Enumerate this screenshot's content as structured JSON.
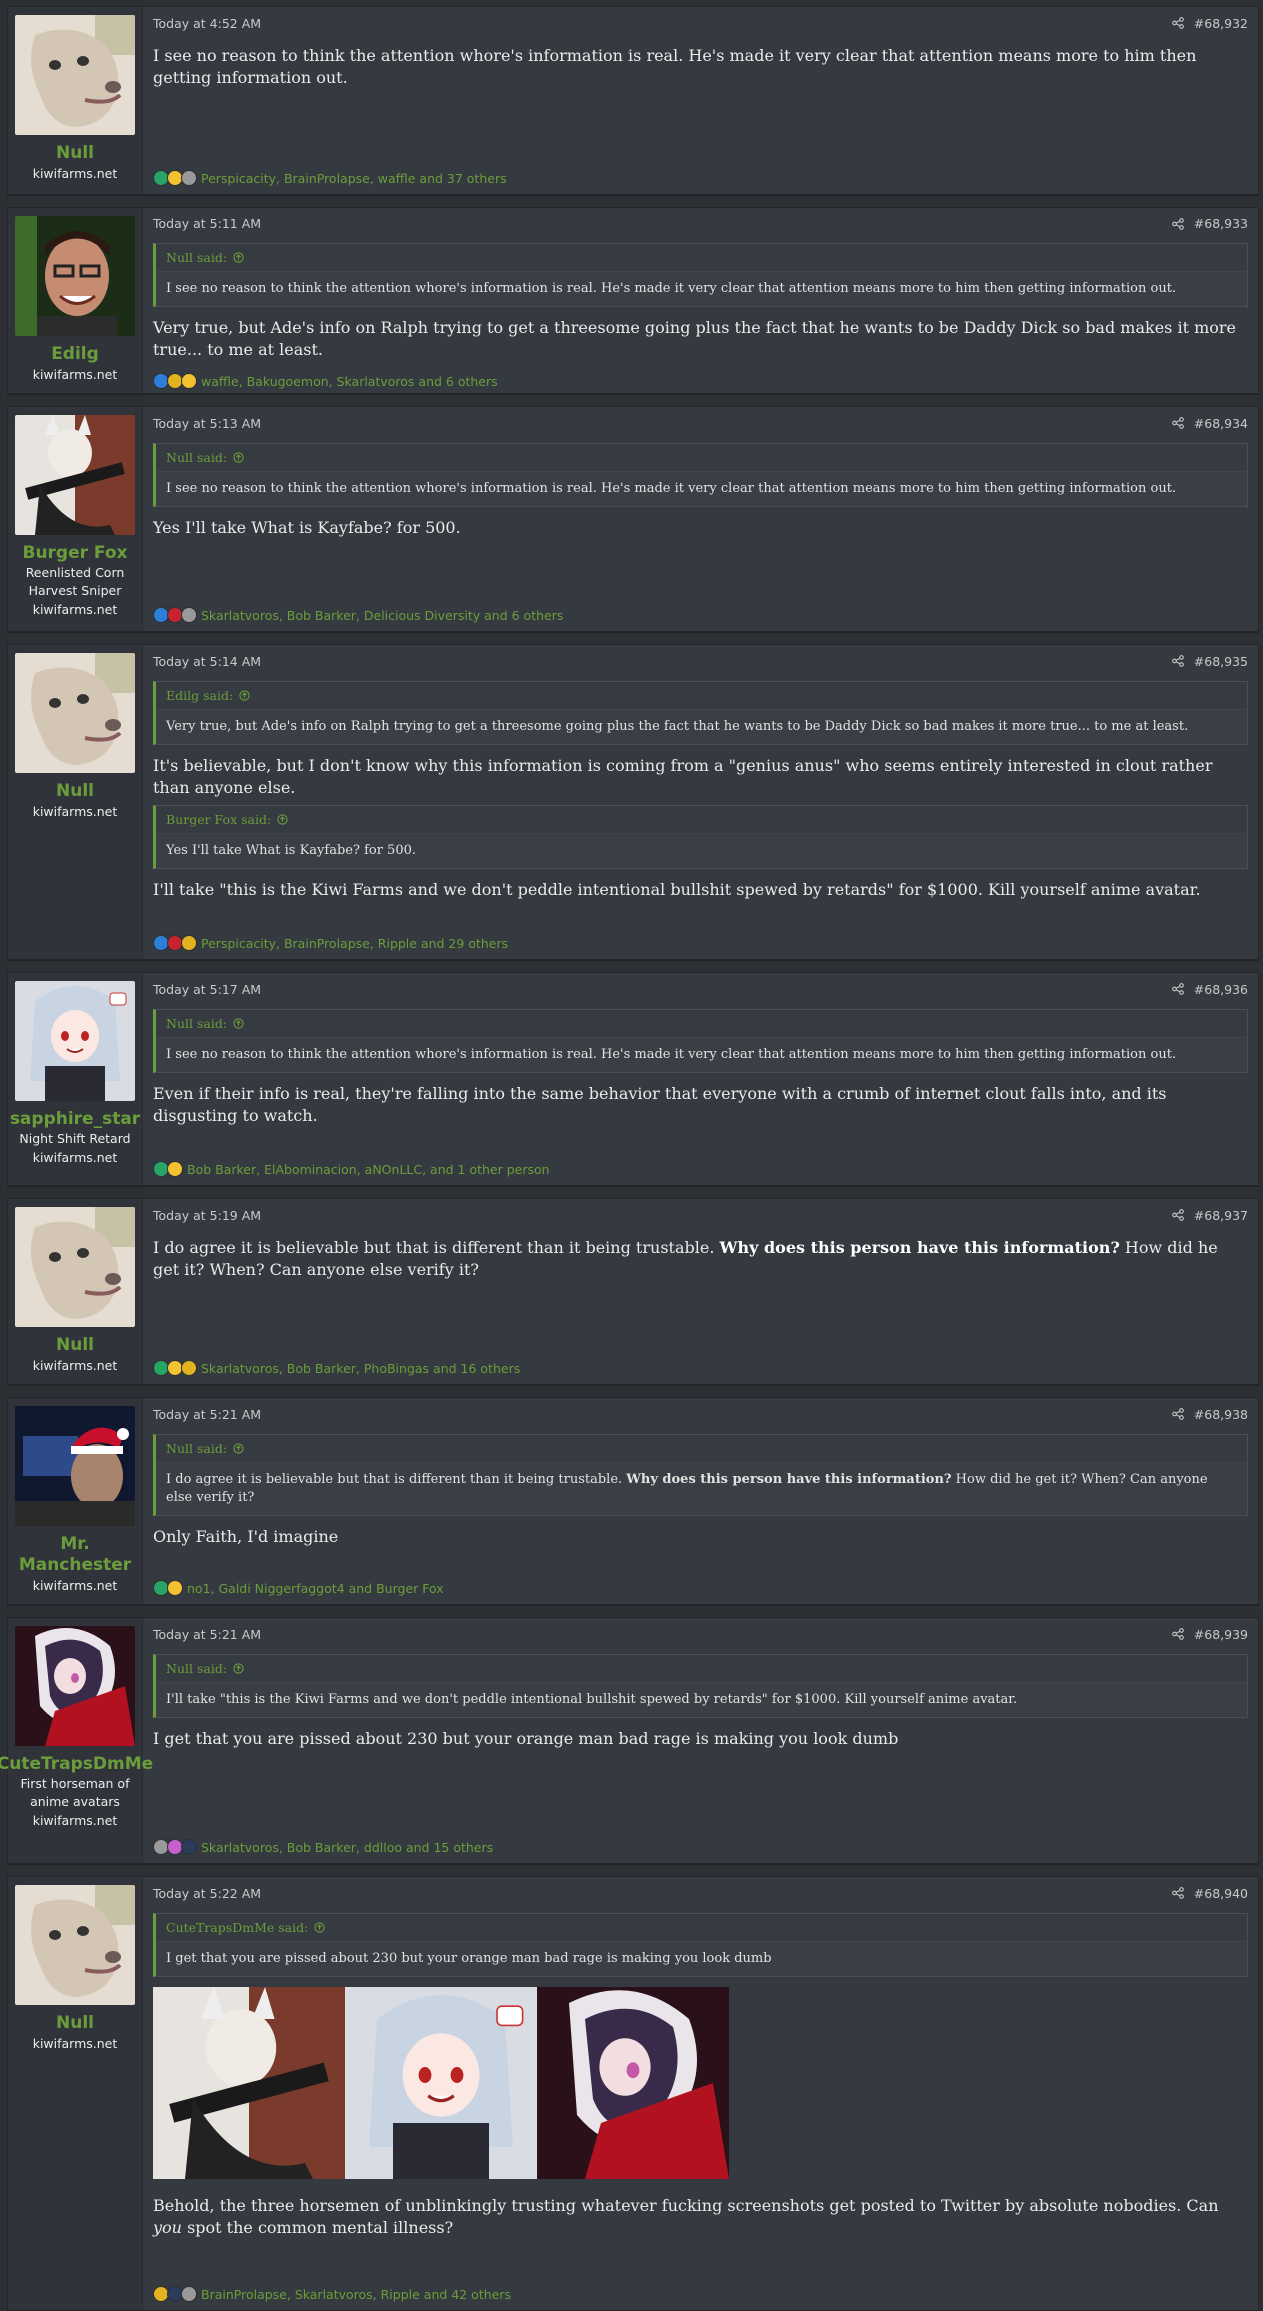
{
  "posts": [
    {
      "avatar": "dog-avatar",
      "avatar_color": "#d9cfc2",
      "username": "Null",
      "user_title": [],
      "site": "kiwifarms.net",
      "time": "Today at 4:52 AM",
      "number": "#68,932",
      "quotes": [],
      "paragraphs": [
        {
          "text": "I see no reason to think the attention whore's information is real. He's made it very clear that attention means more to him then getting information out."
        }
      ],
      "reaction_icons": [
        "check-reaction-icon",
        "thinking-reaction-icon",
        "paper-reaction-icon"
      ],
      "reactions": "Perspicacity, BrainProlapse, waffle and 37 others"
    },
    {
      "avatar": "man-avatar",
      "avatar_color": "#3d2e2a",
      "username": "Edilg",
      "user_title": [],
      "site": "kiwifarms.net",
      "time": "Today at 5:11 AM",
      "number": "#68,933",
      "quotes": [
        {
          "author": "Null said:",
          "text": "I see no reason to think the attention whore's information is real. He's made it very clear that attention means more to him then getting information out."
        }
      ],
      "paragraphs": [
        {
          "text": "Very true, but Ade's info on Ralph trying to get a threesome going plus the fact that he wants to be Daddy Dick so bad makes it more true... to me at least."
        }
      ],
      "reaction_icons": [
        "like-reaction-icon",
        "pineapple-reaction-icon",
        "thinking-reaction-icon"
      ],
      "reactions": "waffle, Bakugoemon, Skarlatvoros and 6 others"
    },
    {
      "avatar": "girl-rifle-avatar",
      "avatar_color": "#6e3a2c",
      "username": "Burger Fox",
      "user_title": [
        "Reenlisted Corn",
        "Harvest Sniper"
      ],
      "site": "kiwifarms.net",
      "time": "Today at 5:13 AM",
      "number": "#68,934",
      "quotes": [
        {
          "author": "Null said:",
          "text": "I see no reason to think the attention whore's information is real. He's made it very clear that attention means more to him then getting information out."
        }
      ],
      "paragraphs": [
        {
          "text": "Yes I'll take What is Kayfabe? for 500."
        }
      ],
      "reaction_icons": [
        "like-reaction-icon",
        "heart-reaction-icon",
        "paper-reaction-icon"
      ],
      "reactions": "Skarlatvoros, Bob Barker, Delicious Diversity and 6 others"
    },
    {
      "avatar": "dog-avatar",
      "avatar_color": "#d9cfc2",
      "username": "Null",
      "user_title": [],
      "site": "kiwifarms.net",
      "time": "Today at 5:14 AM",
      "number": "#68,935",
      "quotes": [
        {
          "author": "Edilg said:",
          "text": "Very true, but Ade's info on Ralph trying to get a threesome going plus the fact that he wants to be Daddy Dick so bad makes it more true... to me at least."
        }
      ],
      "paragraphs": [
        {
          "text": "It's believable, but I don't know why this information is coming from a \"genius anus\" who seems entirely interested in clout rather than anyone else."
        },
        {
          "quote": {
            "author": "Burger Fox said:",
            "text": "Yes I'll take What is Kayfabe? for 500."
          }
        },
        {
          "text": "I'll take \"this is the Kiwi Farms and we don't peddle intentional bullshit spewed by retards\" for $1000. Kill yourself anime avatar."
        }
      ],
      "reaction_icons": [
        "like-reaction-icon",
        "heart-reaction-icon",
        "pineapple-reaction-icon"
      ],
      "reactions": "Perspicacity, BrainProlapse, Ripple and 29 others"
    },
    {
      "avatar": "silver-hair-avatar",
      "avatar_color": "#cfd3d9",
      "username": "sapphire_star",
      "user_title": [
        "Night Shift Retard"
      ],
      "site": "kiwifarms.net",
      "time": "Today at 5:17 AM",
      "number": "#68,936",
      "quotes": [
        {
          "author": "Null said:",
          "text": "I see no reason to think the attention whore's information is real. He's made it very clear that attention means more to him then getting information out."
        }
      ],
      "paragraphs": [
        {
          "text": "Even if their info is real, they're falling into the same behavior that everyone with a crumb of internet clout falls into, and its disgusting to watch."
        }
      ],
      "reaction_icons": [
        "check-reaction-icon",
        "thinking-reaction-icon"
      ],
      "reactions": "Bob Barker, ElAbominacion, aNOnLLC, and 1 other person"
    },
    {
      "avatar": "dog-avatar",
      "avatar_color": "#d9cfc2",
      "username": "Null",
      "user_title": [],
      "site": "kiwifarms.net",
      "time": "Today at 5:19 AM",
      "number": "#68,937",
      "quotes": [],
      "paragraphs": [
        {
          "before": "I do agree it is believable but that is different than it being trustable. ",
          "bold": "Why does this person have this information?",
          "after": " How did he get it? When? Can anyone else verify it?"
        }
      ],
      "reaction_icons": [
        "check-reaction-icon",
        "thinking-reaction-icon",
        "pineapple-reaction-icon"
      ],
      "reactions": "Skarlatvoros, Bob Barker, PhoBingas and 16 others"
    },
    {
      "avatar": "santa-computer-avatar",
      "avatar_color": "#1c2340",
      "username": "Mr. Manchester",
      "user_title": [],
      "site": "kiwifarms.net",
      "time": "Today at 5:21 AM",
      "number": "#68,938",
      "quotes": [
        {
          "author": "Null said:",
          "before": "I do agree it is believable but that is different than it being trustable. ",
          "bold": "Why does this person have this information?",
          "after": " How did he get it? When? Can anyone else verify it?"
        }
      ],
      "paragraphs": [
        {
          "text": "Only Faith, I'd imagine"
        }
      ],
      "reaction_icons": [
        "check-reaction-icon",
        "thinking-reaction-icon"
      ],
      "reactions": "no1, Galdi Niggerfaggot4 and Burger Fox"
    },
    {
      "avatar": "purple-hair-avatar",
      "avatar_color": "#3a1b22",
      "username": "CuteTrapsDmMe",
      "user_title": [
        "First horseman of",
        "anime avatars"
      ],
      "site": "kiwifarms.net",
      "time": "Today at 5:21 AM",
      "number": "#68,939",
      "quotes": [
        {
          "author": "Null said:",
          "text": "I'll take \"this is the Kiwi Farms and we don't peddle intentional bullshit spewed by retards\" for $1000. Kill yourself anime avatar."
        }
      ],
      "paragraphs": [
        {
          "text": "I get that you are pissed about 230 but your orange man bad rage is making you look dumb"
        }
      ],
      "reaction_icons": [
        "paper-reaction-icon",
        "rainbow-reaction-icon",
        "mask-reaction-icon"
      ],
      "reactions": "Skarlatvoros, Bob Barker, ddlloo and 15 others"
    },
    {
      "avatar": "dog-avatar",
      "avatar_color": "#d9cfc2",
      "username": "Null",
      "user_title": [],
      "site": "kiwifarms.net",
      "time": "Today at 5:22 AM",
      "number": "#68,940",
      "quotes": [
        {
          "author": "CuteTrapsDmMe said:",
          "text": "I get that you are pissed about 230 but your orange man bad rage is making you look dumb"
        }
      ],
      "images": [
        "girl-rifle-image",
        "silver-hair-image",
        "purple-hair-image"
      ],
      "paragraphs": [
        {
          "before": "Behold, the three horsemen of unblinkingly trusting whatever fucking screenshots get posted to Twitter by absolute nobodies. Can ",
          "italic": "you",
          "after": " spot the common mental illness?"
        }
      ],
      "reaction_icons": [
        "pineapple-reaction-icon",
        "mask-reaction-icon",
        "paper-reaction-icon"
      ],
      "reactions": "BrainProlapse, Skarlatvoros, Ripple and 42 others"
    }
  ]
}
